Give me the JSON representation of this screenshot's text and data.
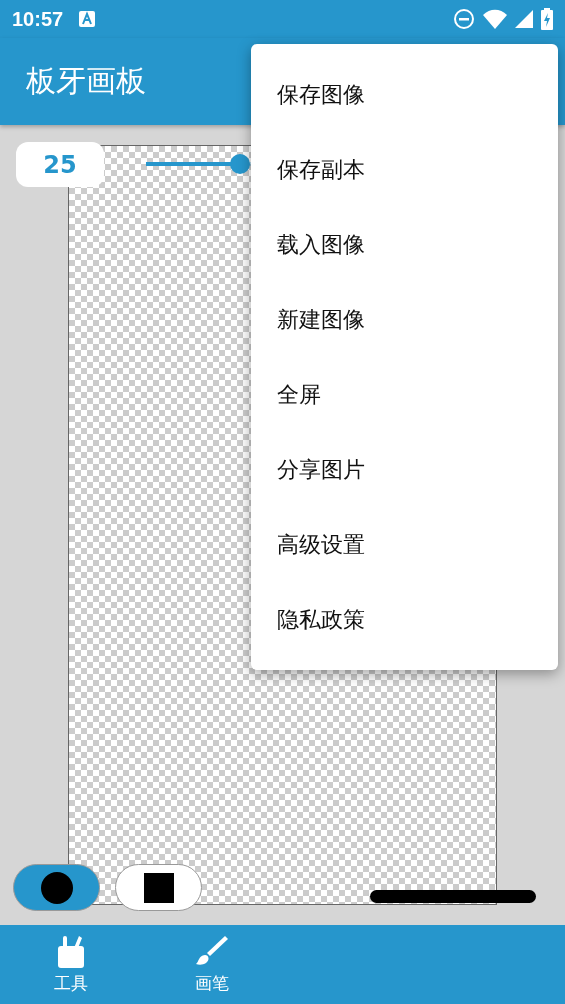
{
  "status_bar": {
    "time": "10:57"
  },
  "app_bar": {
    "title": "板牙画板"
  },
  "brush_size": {
    "value": "25"
  },
  "shape_buttons": [
    {
      "kind": "circle",
      "selected": true
    },
    {
      "kind": "square",
      "selected": false
    }
  ],
  "menu": {
    "items": [
      "保存图像",
      "保存副本",
      "载入图像",
      "新建图像",
      "全屏",
      "分享图片",
      "高级设置",
      "隐私政策"
    ]
  },
  "bottom_nav": [
    {
      "kind": "tools",
      "label": "工具"
    },
    {
      "kind": "brush",
      "label": "画笔"
    }
  ]
}
